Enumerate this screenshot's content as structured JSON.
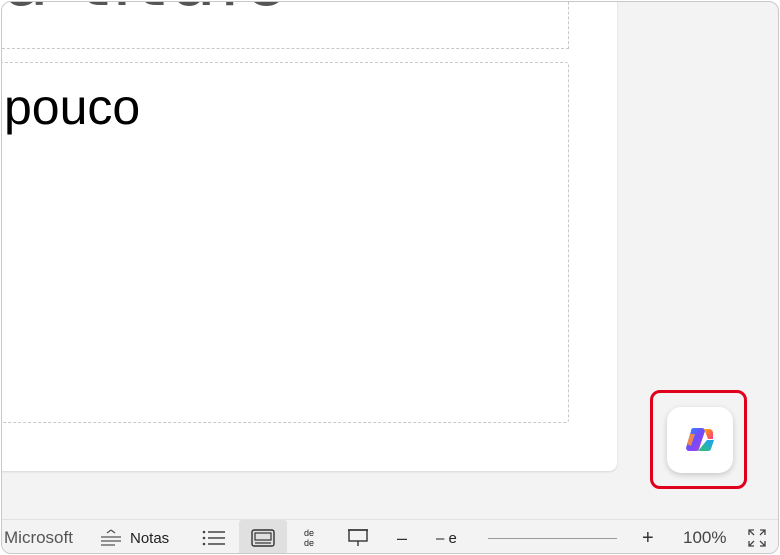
{
  "slide": {
    "title_text": "a título",
    "body_text": "pouco"
  },
  "copilot": {
    "label": "Copilot"
  },
  "statusbar": {
    "app_text": "Microsoft",
    "notes_label": "Notas",
    "reading_label_top": "de",
    "reading_label_bottom": "de",
    "zoom_text": "– e",
    "zoom_level": "100%",
    "zoom_minus": "–",
    "zoom_plus": "+"
  },
  "colors": {
    "highlight": "#e0001b",
    "background": "#f3f3f3"
  }
}
